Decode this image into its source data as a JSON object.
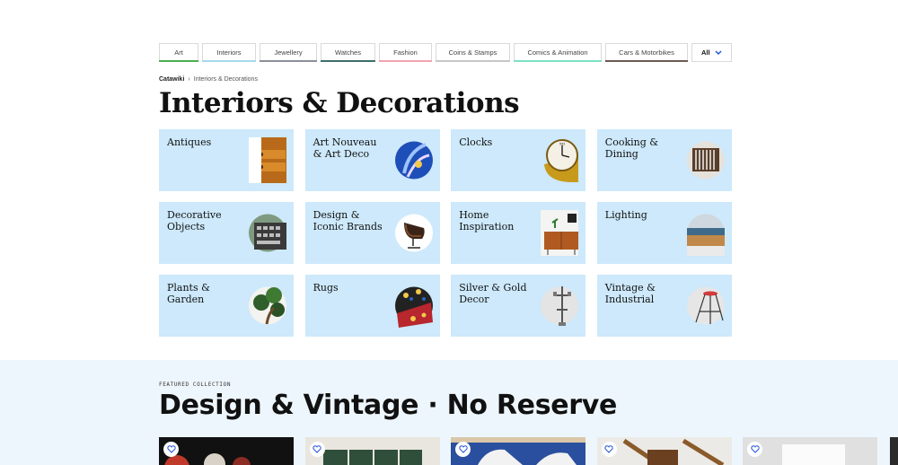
{
  "nav": {
    "tabs": [
      {
        "label": "Art",
        "color": "#4caf50"
      },
      {
        "label": "Interiors",
        "color": "#a8d8ea"
      },
      {
        "label": "Jewellery",
        "color": "#8a8f99"
      },
      {
        "label": "Watches",
        "color": "#3e6f6a"
      },
      {
        "label": "Fashion",
        "color": "#f2a3b3"
      },
      {
        "label": "Coins & Stamps",
        "color": "#c7c7c7"
      },
      {
        "label": "Comics & Animation",
        "color": "#7ee0c5"
      },
      {
        "label": "Cars & Motorbikes",
        "color": "#6b5a55"
      }
    ],
    "all_label": "All"
  },
  "breadcrumb": {
    "home": "Catawiki",
    "separator": "›",
    "current": "Interiors & Decorations"
  },
  "page_title": "Interiors & Decorations",
  "categories": [
    {
      "label": "Antiques",
      "icon": "antique-chest-image"
    },
    {
      "label": "Art Nouveau & Art Deco",
      "icon": "art-nouveau-vase-image"
    },
    {
      "label": "Clocks",
      "icon": "clock-image"
    },
    {
      "label": "Cooking & Dining",
      "icon": "cutlery-image"
    },
    {
      "label": "Decorative Objects",
      "icon": "typewriter-image"
    },
    {
      "label": "Design & Iconic Brands",
      "icon": "lounge-chair-image"
    },
    {
      "label": "Home Inspiration",
      "icon": "sideboard-image"
    },
    {
      "label": "Lighting",
      "icon": "lamp-image"
    },
    {
      "label": "Plants & Garden",
      "icon": "bonsai-image"
    },
    {
      "label": "Rugs",
      "icon": "rug-image"
    },
    {
      "label": "Silver & Gold Decor",
      "icon": "candelabra-image"
    },
    {
      "label": "Vintage & Industrial",
      "icon": "stool-image"
    }
  ],
  "featured": {
    "eyebrow": "FEATURED COLLECTION",
    "title": "Design & Vintage · No Reserve"
  },
  "colors": {
    "tile_bg": "#cde9fb",
    "band_bg": "#eef6fd",
    "accent": "#1d4ed8"
  }
}
